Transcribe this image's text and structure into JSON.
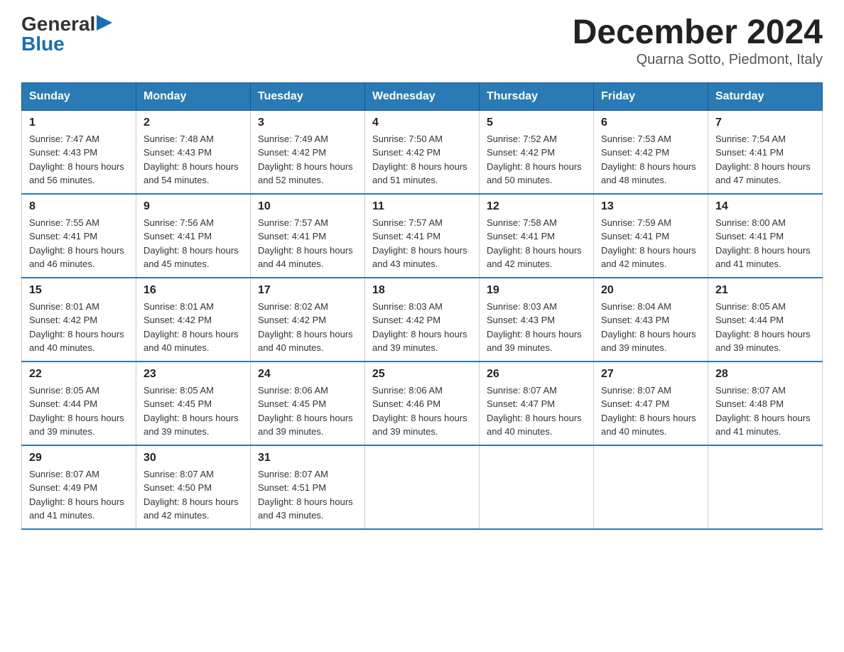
{
  "header": {
    "logo_general": "General",
    "logo_blue": "Blue",
    "title": "December 2024",
    "subtitle": "Quarna Sotto, Piedmont, Italy"
  },
  "days_of_week": [
    "Sunday",
    "Monday",
    "Tuesday",
    "Wednesday",
    "Thursday",
    "Friday",
    "Saturday"
  ],
  "weeks": [
    [
      {
        "day": "1",
        "sunrise": "7:47 AM",
        "sunset": "4:43 PM",
        "daylight": "8 hours and 56 minutes."
      },
      {
        "day": "2",
        "sunrise": "7:48 AM",
        "sunset": "4:43 PM",
        "daylight": "8 hours and 54 minutes."
      },
      {
        "day": "3",
        "sunrise": "7:49 AM",
        "sunset": "4:42 PM",
        "daylight": "8 hours and 52 minutes."
      },
      {
        "day": "4",
        "sunrise": "7:50 AM",
        "sunset": "4:42 PM",
        "daylight": "8 hours and 51 minutes."
      },
      {
        "day": "5",
        "sunrise": "7:52 AM",
        "sunset": "4:42 PM",
        "daylight": "8 hours and 50 minutes."
      },
      {
        "day": "6",
        "sunrise": "7:53 AM",
        "sunset": "4:42 PM",
        "daylight": "8 hours and 48 minutes."
      },
      {
        "day": "7",
        "sunrise": "7:54 AM",
        "sunset": "4:41 PM",
        "daylight": "8 hours and 47 minutes."
      }
    ],
    [
      {
        "day": "8",
        "sunrise": "7:55 AM",
        "sunset": "4:41 PM",
        "daylight": "8 hours and 46 minutes."
      },
      {
        "day": "9",
        "sunrise": "7:56 AM",
        "sunset": "4:41 PM",
        "daylight": "8 hours and 45 minutes."
      },
      {
        "day": "10",
        "sunrise": "7:57 AM",
        "sunset": "4:41 PM",
        "daylight": "8 hours and 44 minutes."
      },
      {
        "day": "11",
        "sunrise": "7:57 AM",
        "sunset": "4:41 PM",
        "daylight": "8 hours and 43 minutes."
      },
      {
        "day": "12",
        "sunrise": "7:58 AM",
        "sunset": "4:41 PM",
        "daylight": "8 hours and 42 minutes."
      },
      {
        "day": "13",
        "sunrise": "7:59 AM",
        "sunset": "4:41 PM",
        "daylight": "8 hours and 42 minutes."
      },
      {
        "day": "14",
        "sunrise": "8:00 AM",
        "sunset": "4:41 PM",
        "daylight": "8 hours and 41 minutes."
      }
    ],
    [
      {
        "day": "15",
        "sunrise": "8:01 AM",
        "sunset": "4:42 PM",
        "daylight": "8 hours and 40 minutes."
      },
      {
        "day": "16",
        "sunrise": "8:01 AM",
        "sunset": "4:42 PM",
        "daylight": "8 hours and 40 minutes."
      },
      {
        "day": "17",
        "sunrise": "8:02 AM",
        "sunset": "4:42 PM",
        "daylight": "8 hours and 40 minutes."
      },
      {
        "day": "18",
        "sunrise": "8:03 AM",
        "sunset": "4:42 PM",
        "daylight": "8 hours and 39 minutes."
      },
      {
        "day": "19",
        "sunrise": "8:03 AM",
        "sunset": "4:43 PM",
        "daylight": "8 hours and 39 minutes."
      },
      {
        "day": "20",
        "sunrise": "8:04 AM",
        "sunset": "4:43 PM",
        "daylight": "8 hours and 39 minutes."
      },
      {
        "day": "21",
        "sunrise": "8:05 AM",
        "sunset": "4:44 PM",
        "daylight": "8 hours and 39 minutes."
      }
    ],
    [
      {
        "day": "22",
        "sunrise": "8:05 AM",
        "sunset": "4:44 PM",
        "daylight": "8 hours and 39 minutes."
      },
      {
        "day": "23",
        "sunrise": "8:05 AM",
        "sunset": "4:45 PM",
        "daylight": "8 hours and 39 minutes."
      },
      {
        "day": "24",
        "sunrise": "8:06 AM",
        "sunset": "4:45 PM",
        "daylight": "8 hours and 39 minutes."
      },
      {
        "day": "25",
        "sunrise": "8:06 AM",
        "sunset": "4:46 PM",
        "daylight": "8 hours and 39 minutes."
      },
      {
        "day": "26",
        "sunrise": "8:07 AM",
        "sunset": "4:47 PM",
        "daylight": "8 hours and 40 minutes."
      },
      {
        "day": "27",
        "sunrise": "8:07 AM",
        "sunset": "4:47 PM",
        "daylight": "8 hours and 40 minutes."
      },
      {
        "day": "28",
        "sunrise": "8:07 AM",
        "sunset": "4:48 PM",
        "daylight": "8 hours and 41 minutes."
      }
    ],
    [
      {
        "day": "29",
        "sunrise": "8:07 AM",
        "sunset": "4:49 PM",
        "daylight": "8 hours and 41 minutes."
      },
      {
        "day": "30",
        "sunrise": "8:07 AM",
        "sunset": "4:50 PM",
        "daylight": "8 hours and 42 minutes."
      },
      {
        "day": "31",
        "sunrise": "8:07 AM",
        "sunset": "4:51 PM",
        "daylight": "8 hours and 43 minutes."
      },
      null,
      null,
      null,
      null
    ]
  ]
}
